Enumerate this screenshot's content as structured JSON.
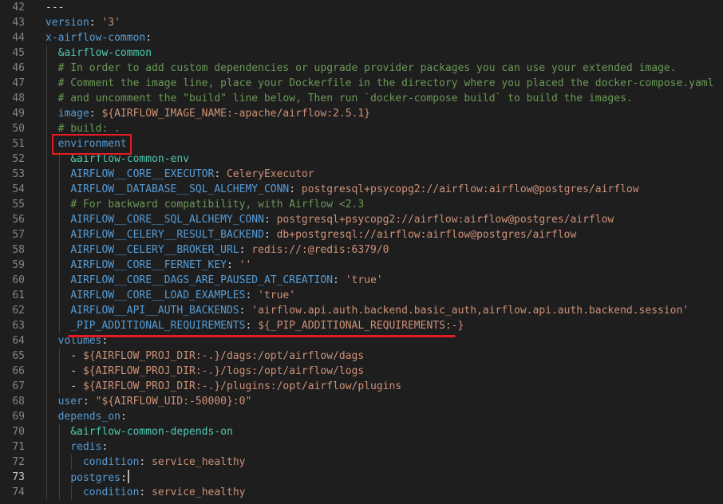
{
  "editor": {
    "current_line": "73",
    "lines": [
      {
        "num": "42",
        "tokens": [
          {
            "t": "p",
            "v": "---"
          }
        ]
      },
      {
        "num": "43",
        "tokens": [
          {
            "t": "k",
            "v": "version"
          },
          {
            "t": "p",
            "v": ": "
          },
          {
            "t": "s",
            "v": "'3'"
          }
        ]
      },
      {
        "num": "44",
        "tokens": [
          {
            "t": "k",
            "v": "x-airflow-common"
          },
          {
            "t": "p",
            "v": ":"
          }
        ]
      },
      {
        "num": "45",
        "tokens": [
          {
            "t": "p",
            "v": "  "
          },
          {
            "t": "a",
            "v": "&airflow-common"
          }
        ]
      },
      {
        "num": "46",
        "tokens": [
          {
            "t": "p",
            "v": "  "
          },
          {
            "t": "c",
            "v": "# In order to add custom dependencies or upgrade provider packages you can use your extended image."
          }
        ]
      },
      {
        "num": "47",
        "tokens": [
          {
            "t": "p",
            "v": "  "
          },
          {
            "t": "c",
            "v": "# Comment the image line, place your Dockerfile in the directory where you placed the docker-compose.yaml"
          }
        ]
      },
      {
        "num": "48",
        "tokens": [
          {
            "t": "p",
            "v": "  "
          },
          {
            "t": "c",
            "v": "# and uncomment the \"build\" line below, Then run `docker-compose build` to build the images."
          }
        ]
      },
      {
        "num": "49",
        "tokens": [
          {
            "t": "p",
            "v": "  "
          },
          {
            "t": "k",
            "v": "image"
          },
          {
            "t": "p",
            "v": ": "
          },
          {
            "t": "s",
            "v": "${AIRFLOW_IMAGE_NAME:-apache/airflow:2.5.1}"
          }
        ]
      },
      {
        "num": "50",
        "tokens": [
          {
            "t": "p",
            "v": "  "
          },
          {
            "t": "c",
            "v": "# build: ."
          }
        ]
      },
      {
        "num": "51",
        "tokens": [
          {
            "t": "p",
            "v": "  "
          },
          {
            "t": "k",
            "v": "environment"
          }
        ]
      },
      {
        "num": "52",
        "tokens": [
          {
            "t": "p",
            "v": "    "
          },
          {
            "t": "a",
            "v": "&airflow-common-env"
          }
        ]
      },
      {
        "num": "53",
        "tokens": [
          {
            "t": "p",
            "v": "    "
          },
          {
            "t": "k",
            "v": "AIRFLOW__CORE__EXECUTOR"
          },
          {
            "t": "p",
            "v": ": "
          },
          {
            "t": "s",
            "v": "CeleryExecutor"
          }
        ]
      },
      {
        "num": "54",
        "tokens": [
          {
            "t": "p",
            "v": "    "
          },
          {
            "t": "k",
            "v": "AIRFLOW__DATABASE__SQL_ALCHEMY_CONN"
          },
          {
            "t": "p",
            "v": ": "
          },
          {
            "t": "s",
            "v": "postgresql+psycopg2://airflow:airflow@postgres/airflow"
          }
        ]
      },
      {
        "num": "55",
        "tokens": [
          {
            "t": "p",
            "v": "    "
          },
          {
            "t": "c",
            "v": "# For backward compatibility, with Airflow <2.3"
          }
        ]
      },
      {
        "num": "56",
        "tokens": [
          {
            "t": "p",
            "v": "    "
          },
          {
            "t": "k",
            "v": "AIRFLOW__CORE__SQL_ALCHEMY_CONN"
          },
          {
            "t": "p",
            "v": ": "
          },
          {
            "t": "s",
            "v": "postgresql+psycopg2://airflow:airflow@postgres/airflow"
          }
        ]
      },
      {
        "num": "57",
        "tokens": [
          {
            "t": "p",
            "v": "    "
          },
          {
            "t": "k",
            "v": "AIRFLOW__CELERY__RESULT_BACKEND"
          },
          {
            "t": "p",
            "v": ": "
          },
          {
            "t": "s",
            "v": "db+postgresql://airflow:airflow@postgres/airflow"
          }
        ]
      },
      {
        "num": "58",
        "tokens": [
          {
            "t": "p",
            "v": "    "
          },
          {
            "t": "k",
            "v": "AIRFLOW__CELERY__BROKER_URL"
          },
          {
            "t": "p",
            "v": ": "
          },
          {
            "t": "s",
            "v": "redis://:@redis:6379/0"
          }
        ]
      },
      {
        "num": "59",
        "tokens": [
          {
            "t": "p",
            "v": "    "
          },
          {
            "t": "k",
            "v": "AIRFLOW__CORE__FERNET_KEY"
          },
          {
            "t": "p",
            "v": ": "
          },
          {
            "t": "s",
            "v": "''"
          }
        ]
      },
      {
        "num": "60",
        "tokens": [
          {
            "t": "p",
            "v": "    "
          },
          {
            "t": "k",
            "v": "AIRFLOW__CORE__DAGS_ARE_PAUSED_AT_CREATION"
          },
          {
            "t": "p",
            "v": ": "
          },
          {
            "t": "s",
            "v": "'true'"
          }
        ]
      },
      {
        "num": "61",
        "tokens": [
          {
            "t": "p",
            "v": "    "
          },
          {
            "t": "k",
            "v": "AIRFLOW__CORE__LOAD_EXAMPLES"
          },
          {
            "t": "p",
            "v": ": "
          },
          {
            "t": "s",
            "v": "'true'"
          }
        ]
      },
      {
        "num": "62",
        "tokens": [
          {
            "t": "p",
            "v": "    "
          },
          {
            "t": "k",
            "v": "AIRFLOW__API__AUTH_BACKENDS"
          },
          {
            "t": "p",
            "v": ": "
          },
          {
            "t": "s",
            "v": "'airflow.api.auth.backend.basic_auth,airflow.api.auth.backend.session'"
          }
        ]
      },
      {
        "num": "63",
        "tokens": [
          {
            "t": "p",
            "v": "    "
          },
          {
            "t": "k",
            "v": "_PIP_ADDITIONAL_REQUIREMENTS"
          },
          {
            "t": "p",
            "v": ": "
          },
          {
            "t": "s",
            "v": "${_PIP_ADDITIONAL_REQUIREMENTS:-}"
          }
        ]
      },
      {
        "num": "64",
        "tokens": [
          {
            "t": "p",
            "v": "  "
          },
          {
            "t": "k",
            "v": "volumes"
          },
          {
            "t": "p",
            "v": ":"
          }
        ]
      },
      {
        "num": "65",
        "tokens": [
          {
            "t": "p",
            "v": "    - "
          },
          {
            "t": "s",
            "v": "${AIRFLOW_PROJ_DIR:-.}/dags:/opt/airflow/dags"
          }
        ]
      },
      {
        "num": "66",
        "tokens": [
          {
            "t": "p",
            "v": "    - "
          },
          {
            "t": "s",
            "v": "${AIRFLOW_PROJ_DIR:-.}/logs:/opt/airflow/logs"
          }
        ]
      },
      {
        "num": "67",
        "tokens": [
          {
            "t": "p",
            "v": "    - "
          },
          {
            "t": "s",
            "v": "${AIRFLOW_PROJ_DIR:-.}/plugins:/opt/airflow/plugins"
          }
        ]
      },
      {
        "num": "68",
        "tokens": [
          {
            "t": "p",
            "v": "  "
          },
          {
            "t": "k",
            "v": "user"
          },
          {
            "t": "p",
            "v": ": "
          },
          {
            "t": "s",
            "v": "\"${AIRFLOW_UID:-50000}:0\""
          }
        ]
      },
      {
        "num": "69",
        "tokens": [
          {
            "t": "p",
            "v": "  "
          },
          {
            "t": "k",
            "v": "depends_on"
          },
          {
            "t": "p",
            "v": ":"
          }
        ]
      },
      {
        "num": "70",
        "tokens": [
          {
            "t": "p",
            "v": "    "
          },
          {
            "t": "a",
            "v": "&airflow-common-depends-on"
          }
        ]
      },
      {
        "num": "71",
        "tokens": [
          {
            "t": "p",
            "v": "    "
          },
          {
            "t": "k",
            "v": "redis"
          },
          {
            "t": "p",
            "v": ":"
          }
        ]
      },
      {
        "num": "72",
        "tokens": [
          {
            "t": "p",
            "v": "      "
          },
          {
            "t": "k",
            "v": "condition"
          },
          {
            "t": "p",
            "v": ": "
          },
          {
            "t": "s",
            "v": "service_healthy"
          }
        ]
      },
      {
        "num": "73",
        "tokens": [
          {
            "t": "p",
            "v": "    "
          },
          {
            "t": "k",
            "v": "postgres"
          },
          {
            "t": "p",
            "v": ":"
          }
        ]
      },
      {
        "num": "74",
        "tokens": [
          {
            "t": "p",
            "v": "      "
          },
          {
            "t": "k",
            "v": "condition"
          },
          {
            "t": "p",
            "v": ": "
          },
          {
            "t": "s",
            "v": "service_healthy"
          }
        ]
      }
    ]
  },
  "annotations": [
    {
      "kind": "box",
      "label": "environment"
    },
    {
      "kind": "underline",
      "label": "_PIP_ADDITIONAL_REQUIREMENTS: ${_PIP_ADDITIONAL_REQUIREMENTS:-}"
    }
  ],
  "colors": {
    "background": "#1e1e1e",
    "key": "#569cd6",
    "string": "#ce9178",
    "comment": "#6a9955",
    "anchor": "#4ec9b0",
    "annotation": "#e51c23"
  }
}
